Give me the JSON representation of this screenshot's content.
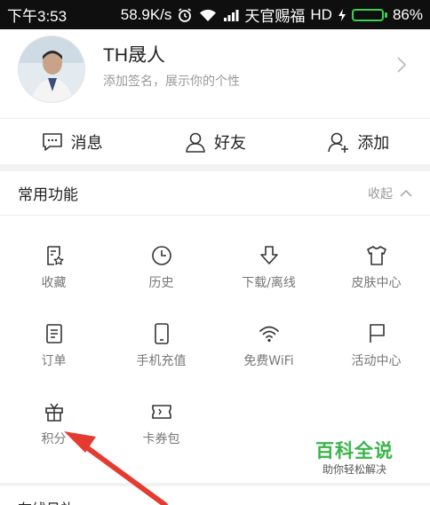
{
  "status_bar": {
    "time": "下午3:53",
    "net_speed": "58.9K/s",
    "carrier": "天官赐福",
    "network_type": "HD",
    "battery": "86%",
    "battery_level": 0.86,
    "battery_color": "#39d353"
  },
  "profile": {
    "name": "TH晟人",
    "signature": "添加签名，展示你的个性"
  },
  "quick_actions": [
    {
      "label": "消息",
      "icon": "message-icon"
    },
    {
      "label": "好友",
      "icon": "person-icon"
    },
    {
      "label": "添加",
      "icon": "add-friend-icon"
    }
  ],
  "section": {
    "title": "常用功能",
    "collapse_label": "收起"
  },
  "functions": [
    {
      "label": "收藏",
      "icon": "favorites-icon"
    },
    {
      "label": "历史",
      "icon": "clock-icon"
    },
    {
      "label": "下载/离线",
      "icon": "download-icon"
    },
    {
      "label": "皮肤中心",
      "icon": "tshirt-icon"
    },
    {
      "label": "订单",
      "icon": "order-list-icon"
    },
    {
      "label": "手机充值",
      "icon": "phone-icon"
    },
    {
      "label": "免费WiFi",
      "icon": "wifi-icon"
    },
    {
      "label": "活动中心",
      "icon": "flag-icon"
    },
    {
      "label": "积分",
      "icon": "gift-icon"
    },
    {
      "label": "卡券包",
      "icon": "ticket-icon"
    }
  ],
  "bottom_section": {
    "title": "在线见礼"
  },
  "watermark": {
    "title": "百科全说",
    "subtitle": "助你轻松解决",
    "color": "#3ab54a"
  },
  "annotation_color": "#e53a2f"
}
